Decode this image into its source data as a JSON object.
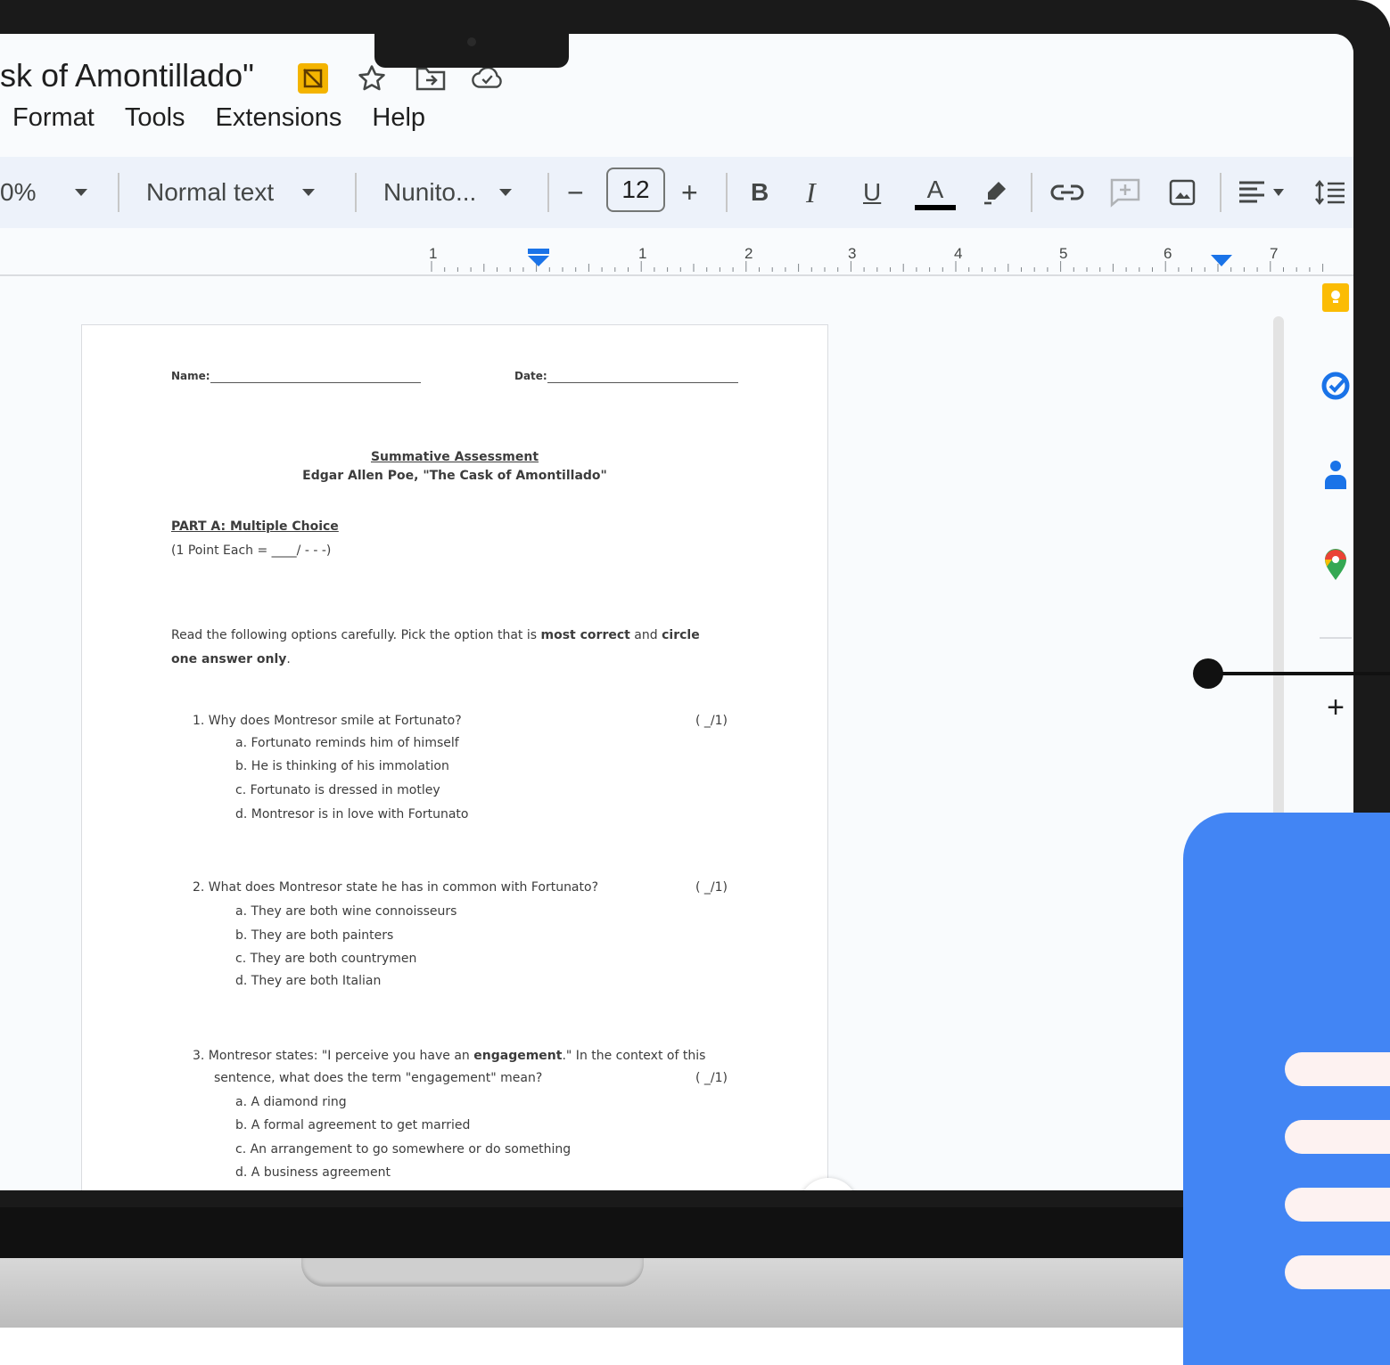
{
  "doc": {
    "title": "sk of Amontillado\"",
    "menu": [
      "Format",
      "Tools",
      "Extensions",
      "Help"
    ]
  },
  "toolbar": {
    "zoom": "0%",
    "style": "Normal text",
    "font": "Nunito...",
    "minus": "−",
    "font_size": "12",
    "plus": "+",
    "bold": "B",
    "italic": "I",
    "underline": "U",
    "text_color": "A"
  },
  "ruler": {
    "ticks": [
      "1",
      "1",
      "2",
      "3",
      "4",
      "5",
      "6",
      "7"
    ]
  },
  "page": {
    "name_label": "Name:",
    "date_label": "Date:",
    "heading1": "Summative Assessment",
    "heading2": "Edgar Allen Poe, \"The Cask of Amontillado\"",
    "part_title": "PART A: Multiple Choice",
    "part_points": "(1 Point Each = ____/ - - -)",
    "instr_1": "Read the following options carefully.  Pick the option that is ",
    "instr_bold1": "most correct",
    "instr_2": " and ",
    "instr_bold2": "circle",
    "instr_bold3": "one answer only",
    "instr_3": ".",
    "questions": [
      {
        "q": "1.  Why does Montresor smile at Fortunato?",
        "score": "( _/1)",
        "options": [
          "a.  Fortunato reminds him of himself",
          "b.  He is thinking of his immolation",
          "c.  Fortunato is dressed in motley",
          "d.  Montresor is in love with Fortunato"
        ]
      },
      {
        "q": "2.  What does Montresor state he has in common with Fortunato?",
        "score": "( _/1)",
        "options": [
          "a.  They are both wine connoisseurs",
          "b.  They are both painters",
          "c.  They are both countrymen",
          "d.  They are both Italian"
        ]
      },
      {
        "q_part1": "3.  Montresor states: \"I perceive you have an ",
        "q_bold": "engagement",
        "q_part2": ".\"  In the context of this",
        "q_line2": "sentence, what does the term \"engagement\" mean?",
        "score": "( _/1)",
        "options": [
          "a.  A diamond ring",
          "b.  A formal agreement to get married",
          "c.  An arrangement to go somewhere or do something",
          "d.  A business agreement"
        ]
      }
    ]
  },
  "side_panel": {
    "icons": [
      "keep-icon",
      "tasks-icon",
      "contacts-icon",
      "maps-icon"
    ],
    "add": "+"
  },
  "colors": {
    "toolbar_bg": "#edf2fa",
    "accent_blue": "#4285f4",
    "ruler_marker": "#1a73e8"
  }
}
